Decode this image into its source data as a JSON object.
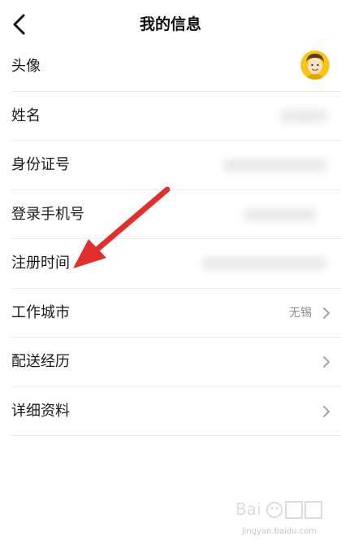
{
  "header": {
    "title": "我的信息",
    "back_icon": "chevron-left-icon"
  },
  "rows": [
    {
      "label": "头像",
      "type": "avatar"
    },
    {
      "label": "姓名",
      "type": "blurred"
    },
    {
      "label": "身份证号",
      "type": "blurred"
    },
    {
      "label": "登录手机号",
      "type": "blurred"
    },
    {
      "label": "注册时间",
      "type": "blurred"
    },
    {
      "label": "工作城市",
      "value": "无锡",
      "type": "link"
    },
    {
      "label": "配送经历",
      "value": "",
      "type": "link"
    },
    {
      "label": "详细资料",
      "value": "",
      "type": "link"
    }
  ],
  "annotation": {
    "arrow_color": "#e0302b"
  },
  "watermark": {
    "logo": "Bai度 经验",
    "domain": "jingyan.baidu.com"
  },
  "colors": {
    "text": "#1a1a1a",
    "value": "#8c8c8c",
    "divider": "#ececec",
    "avatar_bg": "#f5c518"
  }
}
